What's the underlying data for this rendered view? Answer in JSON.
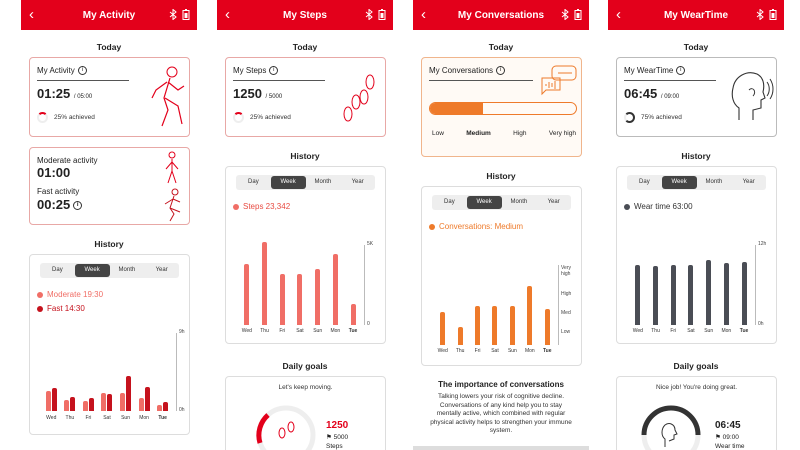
{
  "colors": {
    "brand": "#e3001b",
    "light_red": "#f06e66",
    "dark_red": "#c5121d",
    "orange": "#ee7a2a",
    "dark_gray": "#4a4d55"
  },
  "common": {
    "today": "Today",
    "history": "History",
    "daily_goals": "Daily goals",
    "tabs": [
      "Day",
      "Week",
      "Month",
      "Year"
    ],
    "back_icon": "‹"
  },
  "days": [
    "Wed",
    "Thu",
    "Fri",
    "Sat",
    "Sun",
    "Mon",
    "Tue"
  ],
  "activity": {
    "title": "My Activity",
    "card_label": "My Activity",
    "value": "01:25",
    "goal": "/ 05:00",
    "achieved": "25% achieved",
    "moderate_label": "Moderate activity",
    "moderate_value": "01:00",
    "fast_label": "Fast activity",
    "fast_value": "00:25",
    "legend_moderate": "Moderate 19:30",
    "legend_fast": "Fast 14:30",
    "y_top": "9h",
    "y_bottom": "0h"
  },
  "steps": {
    "title": "My Steps",
    "card_label": "My Steps",
    "value": "1250",
    "goal": "/ 5000",
    "achieved": "25% achieved",
    "legend": "Steps 23,342",
    "y_top": "5K",
    "y_bottom": "0",
    "goal_message": "Let's keep moving.",
    "goal_value": "1250",
    "goal_target": "5000",
    "goal_unit": "Steps"
  },
  "conversations": {
    "title": "My Conversations",
    "card_label": "My Conversations",
    "levels": [
      "Low",
      "Medium",
      "High",
      "Very high"
    ],
    "level_progress": 0.36,
    "legend": "Conversations: Medium",
    "y_ticks": [
      "Very high",
      "High",
      "Med",
      "Low"
    ],
    "importance_title": "The importance of conversations",
    "importance_text": "Talking lowers your risk of cognitive decline. Conversations of any kind help you to stay mentally active, which combined with regular physical activity helps to strengthen your immune system."
  },
  "weartime": {
    "title": "My WearTime",
    "card_label": "My WearTime",
    "value": "06:45",
    "goal": "/ 09:00",
    "achieved": "75% achieved",
    "legend": "Wear time 63:00",
    "y_top": "12h",
    "y_bottom": "0h",
    "goal_message": "Nice job! You're doing great.",
    "goal_value": "06:45",
    "goal_target": "09:00",
    "goal_unit": "Wear time"
  },
  "chart_data": [
    {
      "type": "bar",
      "title": "",
      "categories": [
        "Wed",
        "Thu",
        "Fri",
        "Sat",
        "Sun",
        "Mon",
        "Tue"
      ],
      "series": [
        {
          "name": "Moderate",
          "values": [
            2.3,
            1.3,
            1.1,
            2.1,
            2.1,
            1.5,
            0.7
          ]
        },
        {
          "name": "Fast",
          "values": [
            2.6,
            1.6,
            1.5,
            2.0,
            4.0,
            2.8,
            1.0
          ]
        }
      ],
      "ylim": [
        0,
        9
      ]
    },
    {
      "type": "bar",
      "title": "",
      "categories": [
        "Wed",
        "Thu",
        "Fri",
        "Sat",
        "Sun",
        "Mon",
        "Tue"
      ],
      "series": [
        {
          "name": "Steps",
          "values": [
            3250,
            4400,
            2700,
            2700,
            3000,
            3800,
            1100
          ]
        }
      ],
      "ylim": [
        0,
        5000
      ]
    },
    {
      "type": "bar",
      "title": "",
      "categories": [
        "Wed",
        "Thu",
        "Fri",
        "Sat",
        "Sun",
        "Mon",
        "Tue"
      ],
      "series": [
        {
          "name": "Conversations",
          "values": [
            1.1,
            0.6,
            1.3,
            1.3,
            1.3,
            2.0,
            1.2
          ]
        }
      ],
      "ylim": [
        0,
        2.7
      ]
    },
    {
      "type": "bar",
      "title": "",
      "categories": [
        "Wed",
        "Thu",
        "Fri",
        "Sat",
        "Sun",
        "Mon",
        "Tue"
      ],
      "series": [
        {
          "name": "Wear time",
          "values": [
            9.0,
            8.9,
            9.0,
            9.0,
            9.8,
            9.3,
            9.4
          ]
        }
      ],
      "ylim": [
        0,
        12
      ]
    }
  ]
}
